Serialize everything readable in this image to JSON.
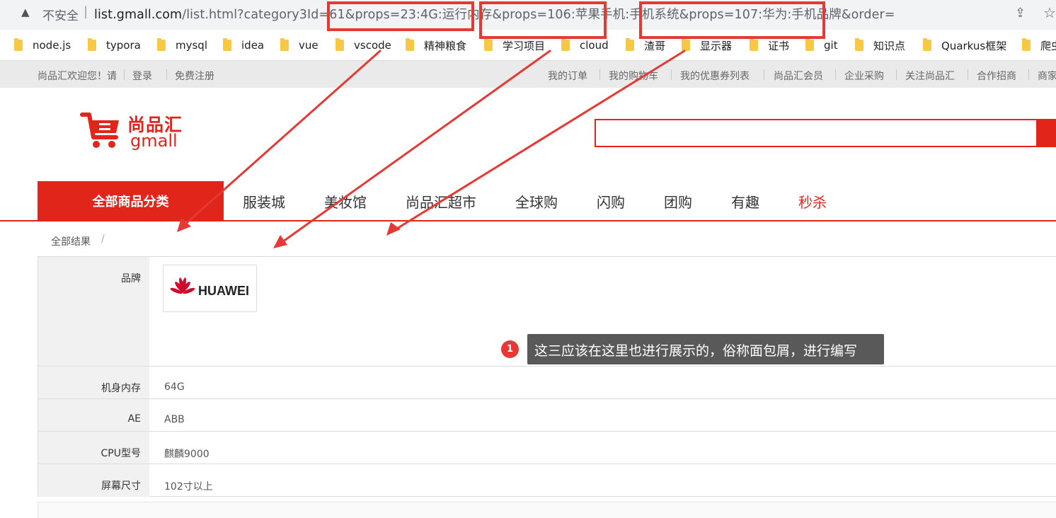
{
  "browser": {
    "insecure_label": "不安全",
    "separator": "|",
    "url_host": "list.gmall.com",
    "url_path": "/list.html?category3Id=61&props=23:4G:运行内存&props=106:苹果手机:手机系统&props=107:华为:手机品牌&order=",
    "icons": [
      "warning-icon",
      "share-icon",
      "bookmark-star-icon"
    ]
  },
  "bookmarks": [
    "node.js",
    "typora",
    "mysql",
    "idea",
    "vue",
    "vscode",
    "精神粮食",
    "学习项目",
    "cloud",
    "渣哥",
    "显示器",
    "证书",
    "git",
    "知识点",
    "Quarkus框架",
    "爬虫"
  ],
  "shortcut": {
    "welcome": "尚品汇欢迎您！请",
    "login": "登录",
    "register": "免费注册",
    "links": [
      "我的订单",
      "我的购物车",
      "我的优惠券列表",
      "尚品汇会员",
      "企业采购",
      "关注尚品汇",
      "合作招商",
      "商家后台"
    ]
  },
  "header": {
    "logo_cn": "尚品汇",
    "logo_en": "gmall",
    "search_placeholder": ""
  },
  "nav": {
    "all_categories": "全部商品分类",
    "items": [
      "服装城",
      "美妆馆",
      "尚品汇超市",
      "全球购",
      "闪购",
      "团购",
      "有趣",
      "秒杀"
    ]
  },
  "breadcrumb": {
    "label": "全部结果",
    "separator": "/"
  },
  "selector": {
    "brand_label": "品牌",
    "brand_logo_text": "HUAWEI",
    "attrs": [
      {
        "key": "机身内存",
        "value": "64G"
      },
      {
        "key": "AE",
        "value": "ABB"
      },
      {
        "key": "CPU型号",
        "value": "麒麟9000"
      },
      {
        "key": "屏幕尺寸",
        "value": "102寸以上"
      }
    ]
  },
  "annotation": {
    "number": "1",
    "note": "这三应该在这里也进行展示的，俗称面包屑，进行编写"
  },
  "colors": {
    "brand_red": "#e1251b",
    "annotation_red": "#e53935",
    "tooltip_bg": "#595959"
  }
}
